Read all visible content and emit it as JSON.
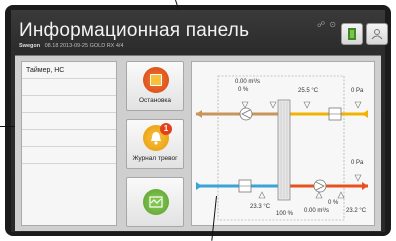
{
  "header": {
    "title": "Информационная панель",
    "brand": "Swegon",
    "info_line": "08.18 2013-09-25  GOLD RX  4/4",
    "status_icons": "☍ ⊙"
  },
  "sidebar": {
    "items": [
      {
        "label": "Таймер, НС"
      },
      {
        "label": ""
      },
      {
        "label": ""
      },
      {
        "label": ""
      },
      {
        "label": ""
      },
      {
        "label": ""
      }
    ]
  },
  "tiles": {
    "stop_label": "Остановка",
    "alarm_log_label": "Журнал тревог",
    "alarm_count": "1"
  },
  "diagram": {
    "exhaust_flow": "0.00 m³/s",
    "exhaust_pct": "0 %",
    "extract_temp": "25.5 °C",
    "extract_pressure": "0 Pa",
    "supply_pressure": "0 Pa",
    "outdoor_temp": "23.3 °C",
    "recovery_pct": "100 %",
    "supply_flow": "0.00 m³/s",
    "supply_pct": "0 %",
    "supply_temp": "23.2 °C"
  },
  "colors": {
    "exhaust_air": "#c8955a",
    "extract_air": "#f0b400",
    "outdoor_air": "#3aa3d8",
    "supply_air": "#e8501f",
    "stop_button": "#e8521c",
    "alarm_button": "#f0a500",
    "diagram_button": "#6db53a"
  }
}
